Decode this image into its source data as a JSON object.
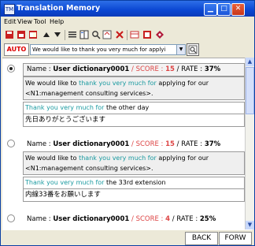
{
  "window": {
    "title": "Translation Memory"
  },
  "menu": [
    "Edit",
    "View",
    "Tool",
    "Help"
  ],
  "toolbar_icons": [
    "save-icon",
    "print-icon",
    "copy-icon",
    "up-arrow-icon",
    "down-arrow-icon",
    "list-icon",
    "columns-icon",
    "search-icon",
    "settings-icon",
    "delete-icon",
    "layout-icon",
    "grid-icon",
    "eraser-icon"
  ],
  "auto": {
    "label": "AUTO"
  },
  "search": {
    "value": "We would like to thank you very much for applyi"
  },
  "labels": {
    "name": "Name : ",
    "score": "SCORE : ",
    "rate": "RATE : ",
    "sep": " / "
  },
  "entries": [
    {
      "selected": true,
      "name": "User dictionary0001",
      "score": "15",
      "rate": "37%",
      "source_pre": "We would like to ",
      "source_hl": "thank you very much for",
      "source_post": " applying for our",
      "source_line2": "<N1:management consulting services>.",
      "match_hl": "Thank you very much for",
      "match_post": " the other day",
      "target": "先日ありがとうございます"
    },
    {
      "selected": false,
      "name": "User dictionary0001",
      "score": "15",
      "rate": "37%",
      "source_pre": "We would like to ",
      "source_hl": "thank you very much for",
      "source_post": " applying for our",
      "source_line2": "<N1:management consulting services>.",
      "match_hl": "Thank you very much for",
      "match_post": " the 33rd extension",
      "target": "内線33番をお願いします"
    },
    {
      "selected": false,
      "name": "User dictionary0001",
      "score": "4",
      "rate": "25%"
    }
  ],
  "nav": {
    "back": "BACK",
    "forward": "FORW"
  }
}
